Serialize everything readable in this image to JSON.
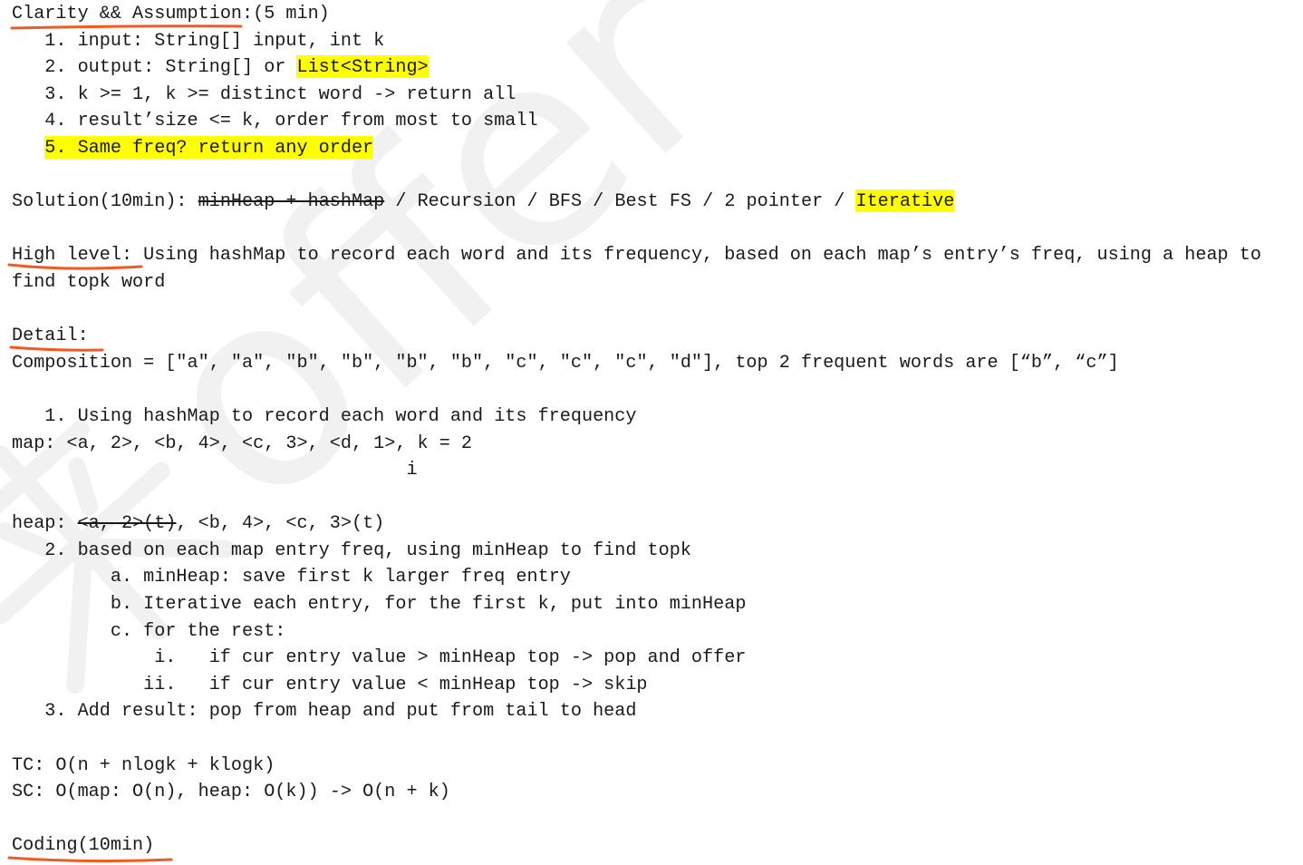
{
  "colors": {
    "text": "#1a1a1a",
    "highlight": "#ffff00",
    "annotation": "#f15a22",
    "watermark": "#f1f1f1",
    "background": "#ffffff"
  },
  "watermark": {
    "glyph": "来",
    "text": "offer"
  },
  "clarity": {
    "heading": "Clarity && Assumption:(5 min)",
    "items": [
      {
        "text": "1. input: String[] input, int k"
      },
      {
        "text": "2. output: String[] or",
        "highlight": "List<String>"
      },
      {
        "text": "3. k >= 1, k >= distinct word -> return all"
      },
      {
        "text": "4. result’size <= k, order from most to small"
      },
      {
        "highlight": "5. Same freq? return any order"
      }
    ]
  },
  "solution": {
    "label": "Solution(10min):",
    "separator": "/",
    "options": [
      {
        "text": "minHeap + hashMap",
        "struck_through": true
      },
      {
        "text": "Recursion"
      },
      {
        "text": "BFS"
      },
      {
        "text": "Best FS"
      },
      {
        "text": "2 pointer"
      },
      {
        "text": "Iterative",
        "highlighted": true
      }
    ]
  },
  "high_level": {
    "label": "High level:",
    "text": "Using hashMap to record each word and its frequency, based on each map’s entry’s freq, using a heap to",
    "text_continued": "find topk word"
  },
  "detail": {
    "label": "Detail:",
    "composition": "Composition = [\"a\", \"a\", \"b\", \"b\", \"b\", \"b\", \"c\", \"c\", \"c\", \"d\"], top 2 frequent words are [“b”, “c”]",
    "step_1": "1. Using hashMap to record each word and its frequency",
    "map": "map: <a, 2>, <b, 4>, <c, 3>, <d, 1>, k = 2",
    "pointer": "i",
    "heap": {
      "label": "heap:",
      "struck_entry": "<a, 2>(t)",
      "remaining_entries": ", <b, 4>, <c, 3>(t)"
    },
    "step_2": "2. based on each map entry freq, using minHeap to find topk",
    "substeps": [
      {
        "text": "a. minHeap: save first k larger freq entry"
      },
      {
        "text": "b. Iterative each entry, for the first k, put into minHeap"
      },
      {
        "text": "c. for the rest:"
      }
    ],
    "cases": [
      {
        "marker": "i.",
        "text": "if cur entry value > minHeap top -> pop and offer"
      },
      {
        "marker": "ii.",
        "text": "if cur entry value < minHeap top -> skip"
      }
    ],
    "step_3": "3. Add result: pop from heap and put from tail to head"
  },
  "complexity": {
    "tc": "TC: O(n + nlogk + klogk)",
    "sc": "SC: O(map: O(n), heap: O(k)) -> O(n + k)"
  },
  "coding": {
    "label": "Coding(10min)"
  }
}
